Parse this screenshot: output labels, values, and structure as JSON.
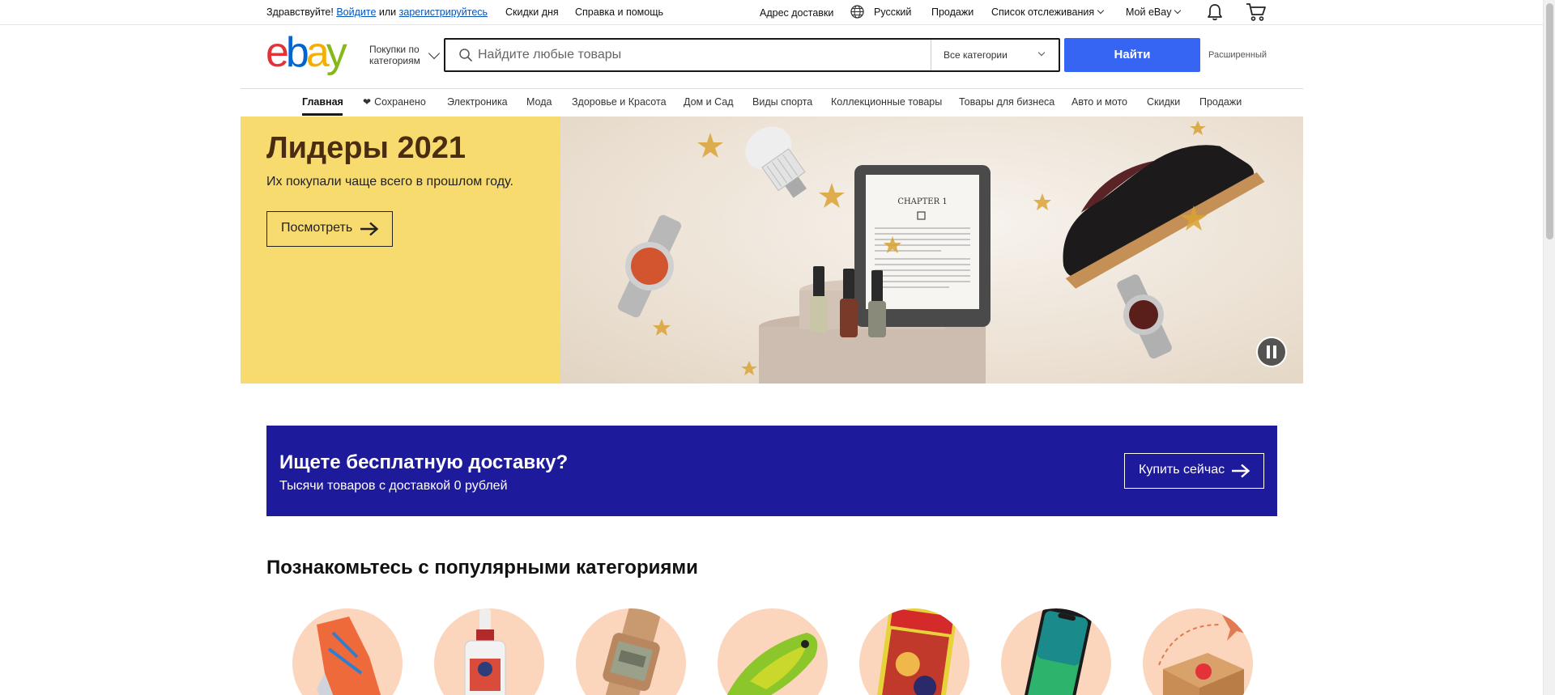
{
  "topbar": {
    "greeting": "Здравствуйте!",
    "login": "Войдите",
    "or": "или",
    "register": "зарегистрируйтесь",
    "deals": "Скидки дня",
    "help": "Справка и помощь",
    "ship_to": "Адрес доставки",
    "language": "Русский",
    "sell": "Продажи",
    "watchlist": "Список отслеживания",
    "my_ebay": "Мой eBay"
  },
  "header": {
    "logo_text": "ebay",
    "shop_by_line1": "Покупки по",
    "shop_by_line2": "категориям",
    "search_placeholder": "Найдите любые товары",
    "category_selected": "Все категории",
    "search_button": "Найти",
    "advanced": "Расширенный"
  },
  "nav": {
    "items": [
      "Главная",
      "Сохранено",
      "Электроника",
      "Мода",
      "Здоровье и Красота",
      "Дом и Сад",
      "Виды спорта",
      "Коллекционные товары",
      "Товары для бизнеса",
      "Авто и мото",
      "Скидки",
      "Продажи"
    ]
  },
  "hero": {
    "title": "Лидеры 2021",
    "subtitle": "Их покупали чаще всего в прошлом году.",
    "button": "Посмотреть",
    "book_chapter": "CHAPTER 1"
  },
  "promo": {
    "title": "Ищете бесплатную доставку?",
    "subtitle": "Тысячи товаров с доставкой 0 рублей",
    "button": "Купить сейчас"
  },
  "categories": {
    "heading": "Познакомьтесь с популярными категориями",
    "items": [
      "sneaker",
      "serum-bottle",
      "watch",
      "fishing-lure",
      "comic-book",
      "smartphone",
      "parcel"
    ]
  },
  "colors": {
    "accent_blue": "#3665f3",
    "hero_yellow": "#f8db6f",
    "promo_navy": "#1e1a9c",
    "category_peach": "#fcd5bd"
  }
}
